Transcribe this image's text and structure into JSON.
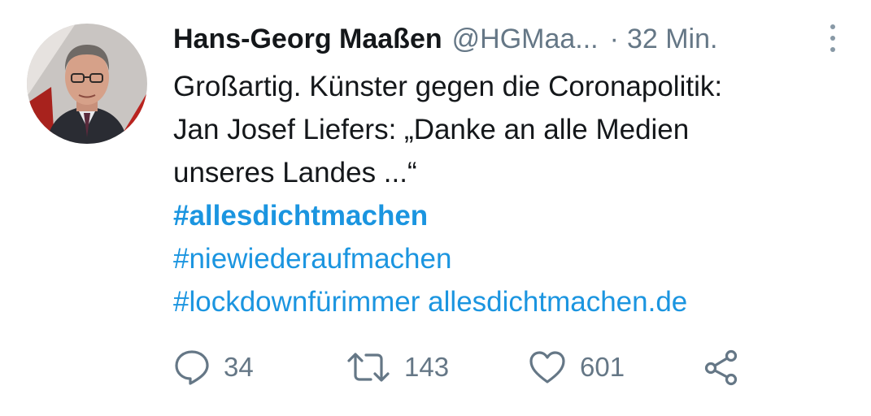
{
  "tweet": {
    "author_name": "Hans-Georg Maaßen",
    "handle": "@HGMaa...",
    "separator": "·",
    "time": "32 Min.",
    "text_lines": [
      "Großartig. Künster gegen die Coronapolitik:",
      "Jan Josef Liefers: „Danke an alle Medien",
      "unseres Landes ...“"
    ],
    "hashtag_1": "#allesdichtmachen",
    "hashtag_2": "#niewiederaufmachen",
    "hashtag_3": "#lockdownfürimmer",
    "link": "allesdichtmachen.de"
  },
  "actions": {
    "reply_icon": "reply-icon",
    "replies": "34",
    "retweet_icon": "retweet-icon",
    "retweets": "143",
    "like_icon": "heart-icon",
    "likes": "601",
    "share_icon": "share-icon"
  },
  "colors": {
    "link": "#1b95e0",
    "muted": "#657786",
    "text": "#14171a"
  }
}
